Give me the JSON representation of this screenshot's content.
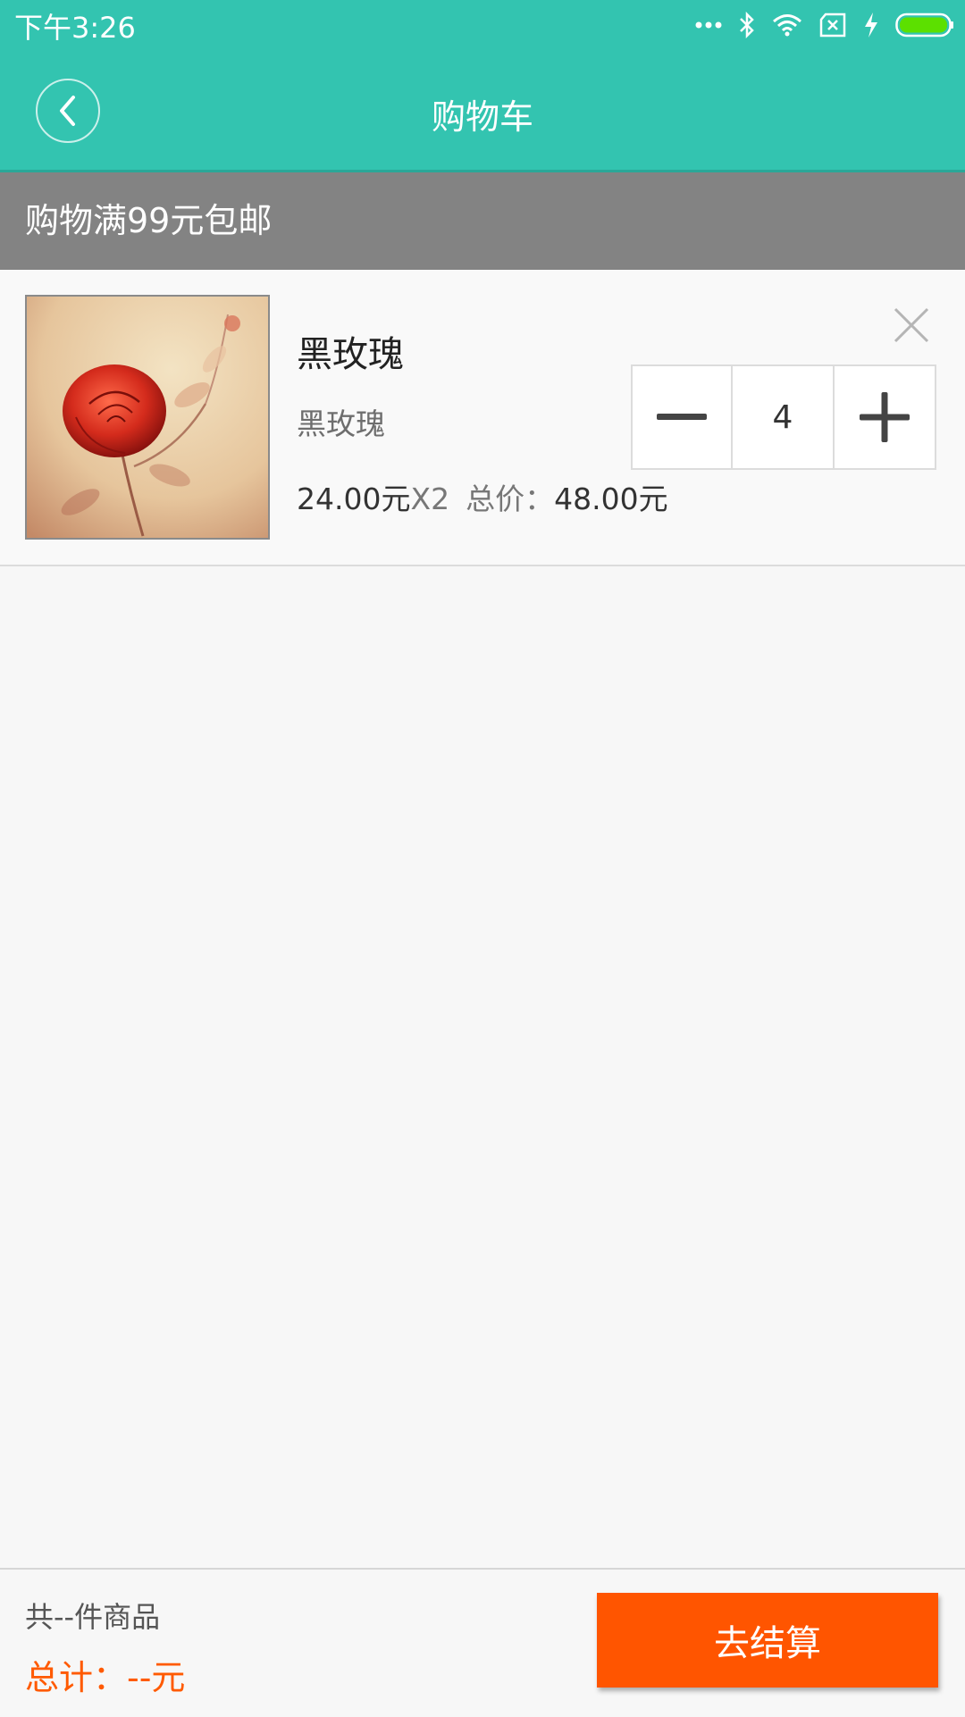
{
  "status_bar": {
    "time": "下午3:26",
    "icons": [
      "more-dots-icon",
      "bluetooth-icon",
      "wifi-icon",
      "no-sim-icon",
      "charging-icon",
      "battery-icon"
    ]
  },
  "header": {
    "title": "购物车",
    "back_icon": "chevron-left-icon"
  },
  "banner": {
    "text": "购物满99元包邮"
  },
  "cart_items": [
    {
      "name": "黑玫瑰",
      "subtitle": "黑玫瑰",
      "unit_price": "24.00元",
      "qty_mult": "X2",
      "total_label": "总价：",
      "total_value": "48.00元",
      "quantity": "4",
      "image": "red-rose-photo"
    }
  ],
  "footer": {
    "count_text": "共--件商品",
    "total_text": "总计：--元",
    "checkout_label": "去结算"
  },
  "colors": {
    "primary": "#33c4b0",
    "banner_bg": "#838383",
    "accent": "#ff5500",
    "total_text": "#ff5a00"
  }
}
